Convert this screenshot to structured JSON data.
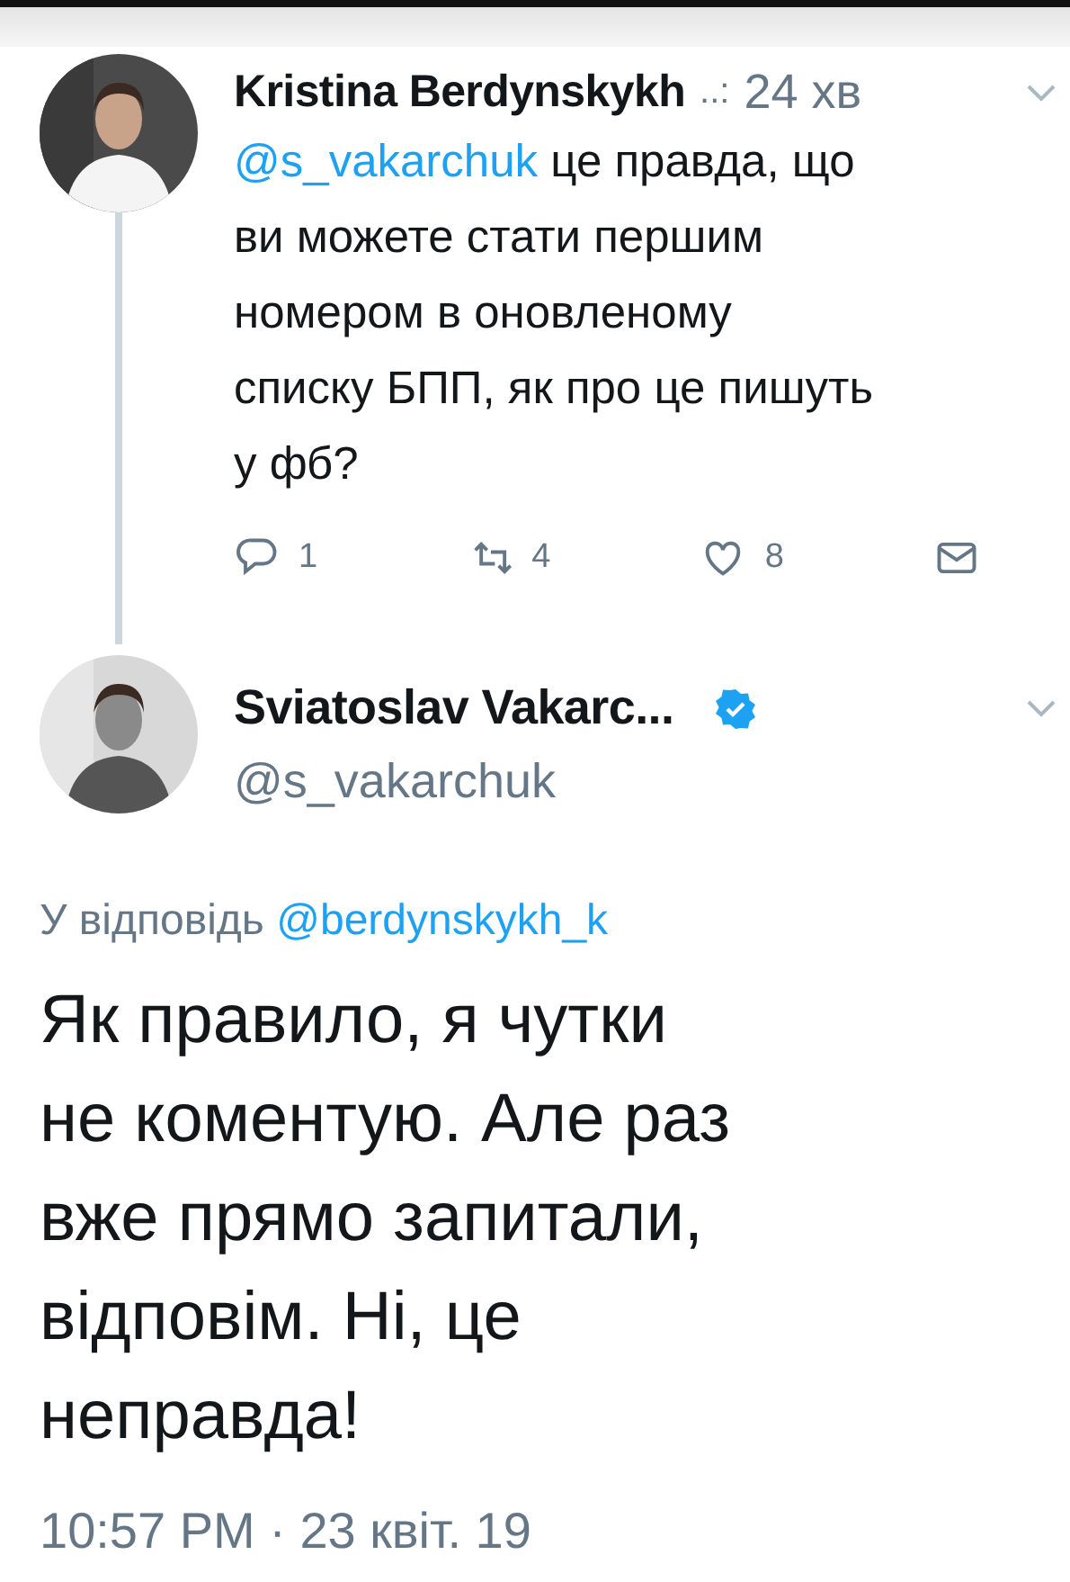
{
  "tweets": [
    {
      "kind": "parent",
      "name": "Kristina Berdynskykh",
      "dots": "..:",
      "time": "24 хв",
      "mention": "@s_vakarchuk",
      "text": " це правда, що\nви можете стати першим\nномером в оновленому\nсписку БПП, як про це пишуть\nу фб?",
      "actions": [
        {
          "kind": "reply",
          "count": "1"
        },
        {
          "kind": "retweet",
          "count": "4"
        },
        {
          "kind": "like",
          "count": "8"
        },
        {
          "kind": "message"
        }
      ]
    },
    {
      "kind": "main",
      "name": "Sviatoslav Vakarc...",
      "verified": true,
      "handle": "@s_vakarchuk",
      "reply_label": "У відповідь",
      "reply_to": "@berdynskykh_k",
      "text": "Як правило, я чутки\nне коментую. Але раз\nвже прямо запитали,\nвідповім. Ні, це\nнеправда!",
      "timestamp": "10:57 PM · 23 квіт. 19"
    }
  ]
}
